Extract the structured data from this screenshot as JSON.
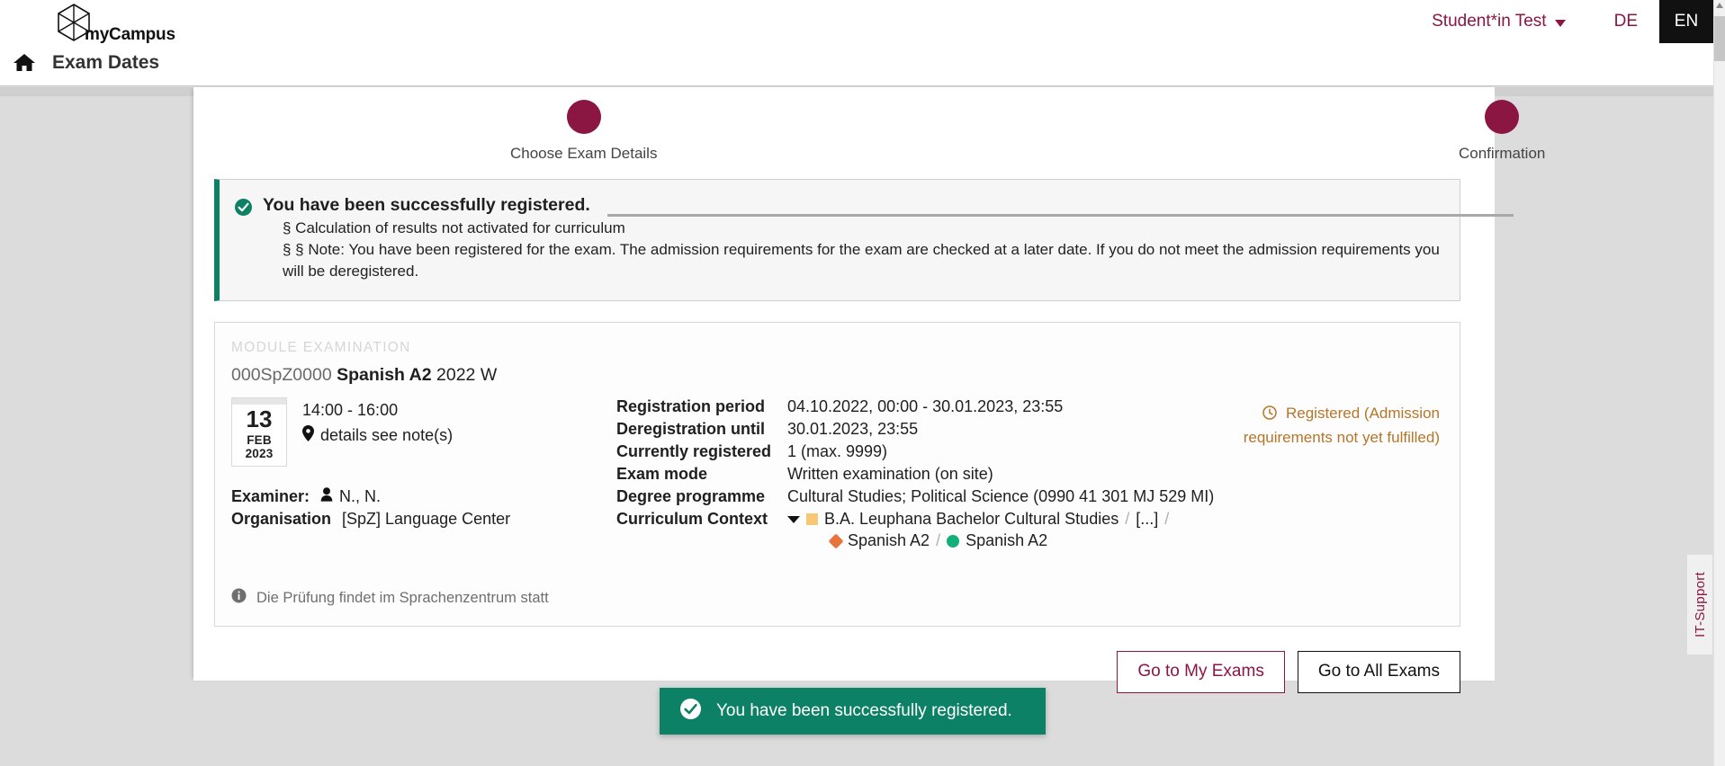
{
  "header": {
    "logo_text": "myCampus",
    "logo_icon": "hexagon-cube-icon",
    "home_icon": "home-icon",
    "breadcrumb_label": "Exam Dates",
    "user_label": "Student*in Test",
    "lang_de": "DE",
    "lang_en": "EN"
  },
  "stepper": {
    "step1_label": "Choose Exam Details",
    "step2_label": "Confirmation",
    "accent_color": "#8b1641"
  },
  "alert": {
    "icon": "check-circle-icon",
    "title": "You have been successfully registered.",
    "line1": "§ Calculation of results not activated for curriculum",
    "line2": "§ § Note: You have been registered for the exam. The admission requirements for the exam are checked at a later date. If you do not meet the admission requirements you will be deregistered.",
    "accent_color": "#0d8065"
  },
  "card": {
    "kicker": "MODULE EXAMINATION",
    "code": "000SpZ0000",
    "name": "Spanish A2",
    "term": "2022 W",
    "date": {
      "day": "13",
      "month_year": "FEB 2023"
    },
    "time": "14:00 - 16:00",
    "venue_icon": "location-pin-icon",
    "venue": "details see note(s)",
    "examiner_label": "Examiner:",
    "examiner_icon": "person-icon",
    "examiner_value": "N., N.",
    "organisation_label": "Organisation",
    "organisation_value": "[SpZ] Language Center",
    "details": [
      {
        "label": "Registration period",
        "value": "04.10.2022, 00:00 - 30.01.2023, 23:55"
      },
      {
        "label": "Deregistration until",
        "value": "30.01.2023, 23:55"
      },
      {
        "label": "Currently registered",
        "value": "1 (max. 9999)"
      },
      {
        "label": "Exam mode",
        "value": "Written examination (on site)"
      },
      {
        "label": "Degree programme",
        "value": "Cultural Studies; Political Science (0990 41 301 MJ 529 MI)"
      }
    ],
    "curriculum": {
      "label": "Curriculum Context",
      "chevron_icon": "chevron-down-icon",
      "node1": "B.A. Leuphana Bachelor Cultural Studies",
      "sep": "/",
      "ellipsis": "[...]",
      "node2": "Spanish A2",
      "node3": "Spanish A2",
      "square_color": "#f7c773",
      "diamond_color": "#e8743b",
      "circle_color": "#11b07a"
    },
    "status": {
      "icon": "clock-icon",
      "text": "Registered (Admission requirements not yet fulfilled)",
      "color": "#b5762a"
    },
    "note": {
      "icon": "info-icon",
      "text": "Die Prüfung findet im Sprachenzentrum statt"
    }
  },
  "footer": {
    "primary_button": "Go to My Exams",
    "secondary_button": "Go to All Exams"
  },
  "toast": {
    "icon": "check-circle-icon",
    "text": "You have been successfully registered.",
    "color": "#0d8165"
  },
  "side_tab": {
    "label": "IT-Support"
  }
}
